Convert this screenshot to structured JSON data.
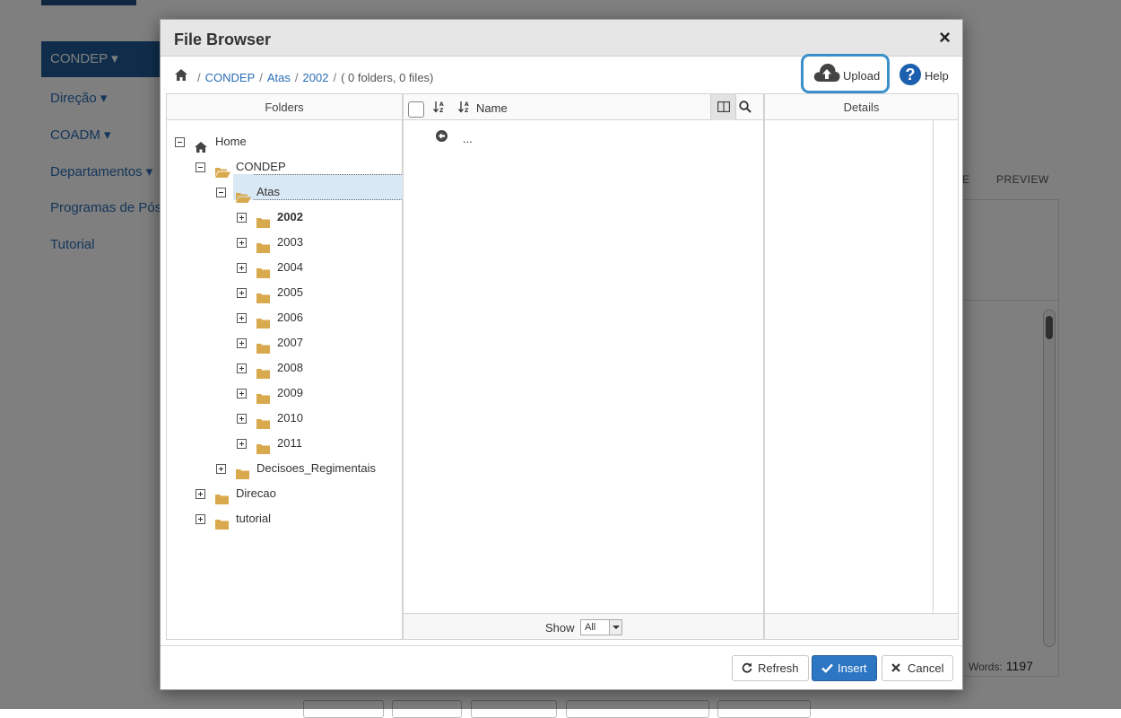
{
  "background": {
    "nav": [
      {
        "label": "CONDEP ▾"
      },
      {
        "label": "Direção ▾"
      },
      {
        "label": "COADM ▾"
      },
      {
        "label": "Departamentos ▾"
      },
      {
        "label": "Programas de Pós-"
      },
      {
        "label": "Tutorial"
      }
    ],
    "tabs": {
      "partial": "E",
      "preview": "PREVIEW"
    },
    "words_label": "Words:",
    "words_count": "1197"
  },
  "dialog": {
    "title": "File Browser",
    "close_glyph": "×",
    "breadcrumb": {
      "items": [
        "CONDEP",
        "Atas",
        "2002"
      ],
      "info": "( 0 folders, 0 files)",
      "separator": "/"
    },
    "upload_label": "Upload",
    "help_label": "Help",
    "help_glyph": "?",
    "folders_header": "Folders",
    "files": {
      "name_header": "Name",
      "back_label": "..."
    },
    "details_header": "Details",
    "show_label": "Show",
    "show_value": "All",
    "tree": [
      {
        "label": "Home",
        "level": 0,
        "state": "expanded",
        "icon": "home-icon"
      },
      {
        "label": "CONDEP",
        "level": 1,
        "state": "expanded",
        "icon": "folder-open-icon"
      },
      {
        "label": "Atas",
        "level": 2,
        "state": "expanded",
        "icon": "folder-open-icon"
      },
      {
        "label": "2002",
        "level": 3,
        "state": "collapsed",
        "icon": "folder-icon",
        "selected": true
      },
      {
        "label": "2003",
        "level": 3,
        "state": "collapsed",
        "icon": "folder-icon"
      },
      {
        "label": "2004",
        "level": 3,
        "state": "collapsed",
        "icon": "folder-icon"
      },
      {
        "label": "2005",
        "level": 3,
        "state": "collapsed",
        "icon": "folder-icon"
      },
      {
        "label": "2006",
        "level": 3,
        "state": "collapsed",
        "icon": "folder-icon"
      },
      {
        "label": "2007",
        "level": 3,
        "state": "collapsed",
        "icon": "folder-icon"
      },
      {
        "label": "2008",
        "level": 3,
        "state": "collapsed",
        "icon": "folder-icon"
      },
      {
        "label": "2009",
        "level": 3,
        "state": "collapsed",
        "icon": "folder-icon"
      },
      {
        "label": "2010",
        "level": 3,
        "state": "collapsed",
        "icon": "folder-icon"
      },
      {
        "label": "2011",
        "level": 3,
        "state": "collapsed",
        "icon": "folder-icon"
      },
      {
        "label": "Decisoes_Regimentais",
        "level": 2,
        "state": "collapsed",
        "icon": "folder-icon"
      },
      {
        "label": "Direcao",
        "level": 1,
        "state": "collapsed",
        "icon": "folder-icon"
      },
      {
        "label": "tutorial",
        "level": 1,
        "state": "collapsed",
        "icon": "folder-icon"
      }
    ],
    "buttons": {
      "refresh": "Refresh",
      "insert": "Insert",
      "cancel": "Cancel"
    },
    "colors": {
      "accent": "#2c76c3",
      "link": "#2a6db5",
      "folder": "#d9a94e",
      "highlight": "#3a8fc9"
    }
  }
}
